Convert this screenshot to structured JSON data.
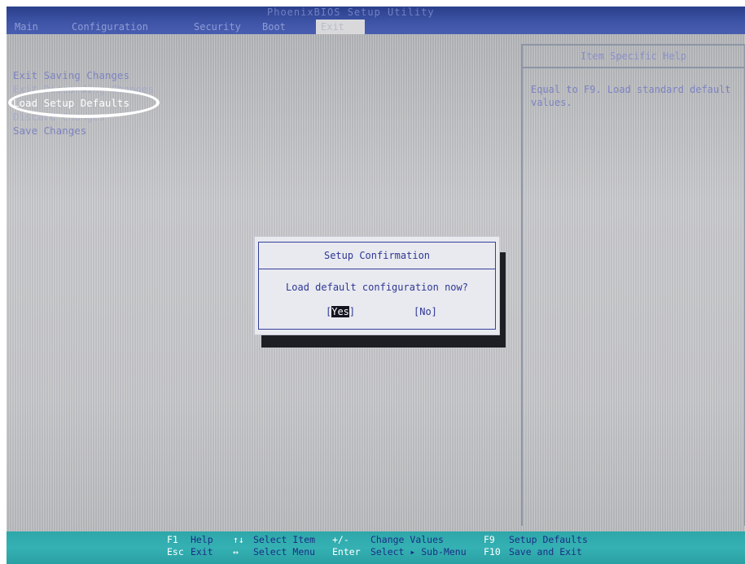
{
  "header": {
    "title": "PhoenixBIOS Setup Utility",
    "menus": [
      "Main",
      "Configuration",
      "Security",
      "Boot",
      "Exit"
    ],
    "active_menu": "Exit"
  },
  "options": [
    "Exit Saving Changes",
    "Exit Discarding Changes",
    "Load Setup Defaults",
    "Discard Changes",
    "Save Changes"
  ],
  "selected_option_index": 2,
  "help": {
    "title": "Item Specific Help",
    "text": "Equal to F9. Load standard default values."
  },
  "dialog": {
    "title": "Setup Confirmation",
    "message": "Load default configuration now?",
    "yes_open": "[",
    "yes_label": "Yes",
    "yes_close": "]",
    "no_label": "[No]",
    "selected_button": "Yes"
  },
  "footer": {
    "row1": [
      {
        "key": "F1",
        "action": "Help"
      },
      {
        "key": "↑↓",
        "action": "Select Item"
      },
      {
        "key": "+/-",
        "action": "Change Values"
      },
      {
        "key": "F9",
        "action": "Setup Defaults"
      }
    ],
    "row2": [
      {
        "key": "Esc",
        "action": "Exit"
      },
      {
        "key": "↔",
        "action": "Select Menu"
      },
      {
        "key": "Enter",
        "action": "Select ▸ Sub-Menu"
      },
      {
        "key": "F10",
        "action": "Save and Exit"
      }
    ]
  },
  "colors": {
    "top_bar": "#3f55a8",
    "bottom_bar": "#2ea7a9",
    "background": "#c3c4c7",
    "dialog_text": "#2e3793",
    "annotation_ring": "#ffffff"
  }
}
